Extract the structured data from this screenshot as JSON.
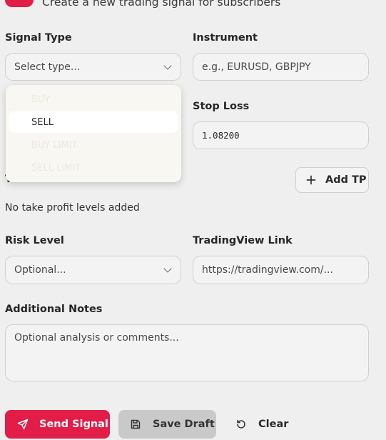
{
  "header": {
    "subtitle": "Create a new trading signal for subscribers"
  },
  "signal_type": {
    "label": "Signal Type",
    "value": "Select type...",
    "options": [
      "BUY",
      "SELL",
      "BUY LIMIT",
      "SELL LIMIT"
    ],
    "highlighted": "SELL"
  },
  "instrument": {
    "label": "Instrument",
    "placeholder": "e.g., EURUSD, GBPJPY"
  },
  "stop_loss": {
    "label": "Stop Loss",
    "value": "1.08200"
  },
  "take_profit": {
    "label": "Take Profit Levels",
    "add_label": "Add TP",
    "empty_text": "No take profit levels added"
  },
  "risk_level": {
    "label": "Risk Level",
    "value": "Optional..."
  },
  "tradingview": {
    "label": "TradingView Link",
    "placeholder": "https://tradingview.com/..."
  },
  "notes": {
    "label": "Additional Notes",
    "placeholder": "Optional analysis or comments..."
  },
  "actions": {
    "send": "Send Signal",
    "save": "Save Draft",
    "clear": "Clear"
  },
  "colors": {
    "accent": "#e11d48",
    "background": "#efefef",
    "secondary_button": "#c9c9c9"
  }
}
